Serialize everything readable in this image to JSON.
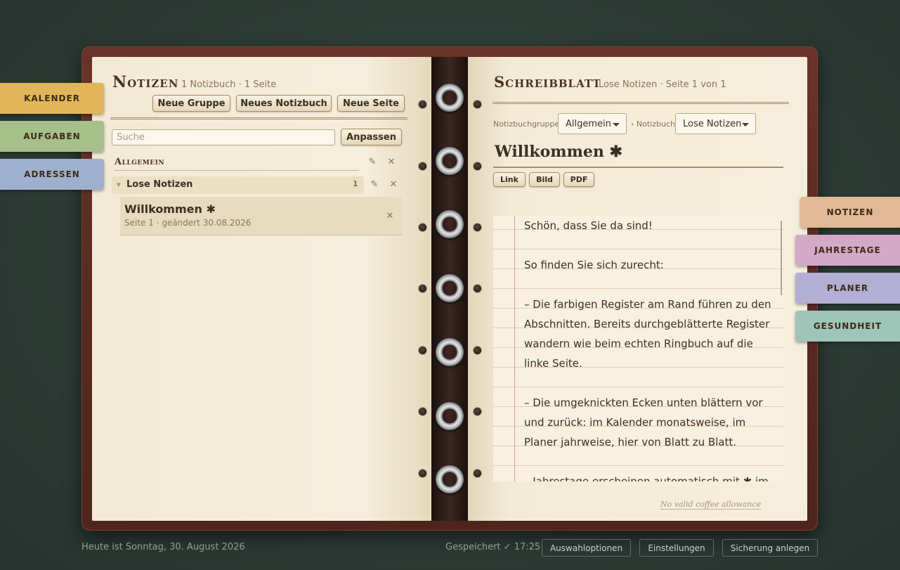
{
  "tabs_left": [
    {
      "label": "KALENDER",
      "color": "#e2b55a"
    },
    {
      "label": "AUFGABEN",
      "color": "#a6c089"
    },
    {
      "label": "ADRESSEN",
      "color": "#9fb0cf"
    }
  ],
  "tabs_right": [
    {
      "label": "NOTIZEN",
      "color": "#e2b996"
    },
    {
      "label": "JAHRESTAGE",
      "color": "#d3a9c8"
    },
    {
      "label": "PLANER",
      "color": "#b3aed4"
    },
    {
      "label": "GESUNDHEIT",
      "color": "#9fc4b8"
    }
  ],
  "left_page": {
    "title": "Notizen",
    "subtitle": "1 Notizbuch · 1 Seite",
    "buttons": {
      "new_group": "Neue Gruppe",
      "new_notebook": "Neues Notizbuch",
      "new_page": "Neue Seite"
    },
    "search_placeholder": "Suche",
    "adjust_button": "Anpassen",
    "group": {
      "label": "Allgemein",
      "edit_icon": "✎",
      "delete_icon": "✕"
    },
    "notebook": {
      "arrow": "▾",
      "label": "Lose Notizen",
      "count": "1",
      "edit_icon": "✎",
      "delete_icon": "✕"
    },
    "page_item": {
      "title": "Willkommen ✱",
      "meta": "Seite 1 · geändert 30.08.2026",
      "delete_icon": "✕"
    }
  },
  "right_page": {
    "title": "Schreibblatt",
    "subtitle": "Lose Notizen · Seite 1 von 1",
    "group_label": "Notizbuchgruppe",
    "group_value": "Allgemein",
    "notebook_label": "› Notizbuch",
    "notebook_value": "Lose Notizen",
    "note_title": "Willkommen ✱",
    "insert_buttons": {
      "link": "Link",
      "image": "Bild",
      "pdf": "PDF"
    },
    "note_body": "Schön, dass Sie da sind!\n\nSo finden Sie sich zurecht:\n\n– Die farbigen Register am Rand führen zu den Abschnitten. Bereits durchgeblätterte Register wandern wie beim echten Ringbuch auf die linke Seite.\n\n– Die umgeknickten Ecken unten blättern vor und zurück: im Kalender monatsweise, im Planer jahrweise, hier von Blatt zu Blatt.\n\n– Jahrestage erscheinen automatisch mit ✱ im",
    "footer_link": "No valid coffee allowance"
  },
  "footer": {
    "date_text": "Heute ist Sonntag, 30. August 2026",
    "saved_text": "Gespeichert ✓ 17:25",
    "btn_options": "Auswahloptionen",
    "btn_settings": "Einstellungen",
    "btn_backup": "Sicherung anlegen"
  }
}
